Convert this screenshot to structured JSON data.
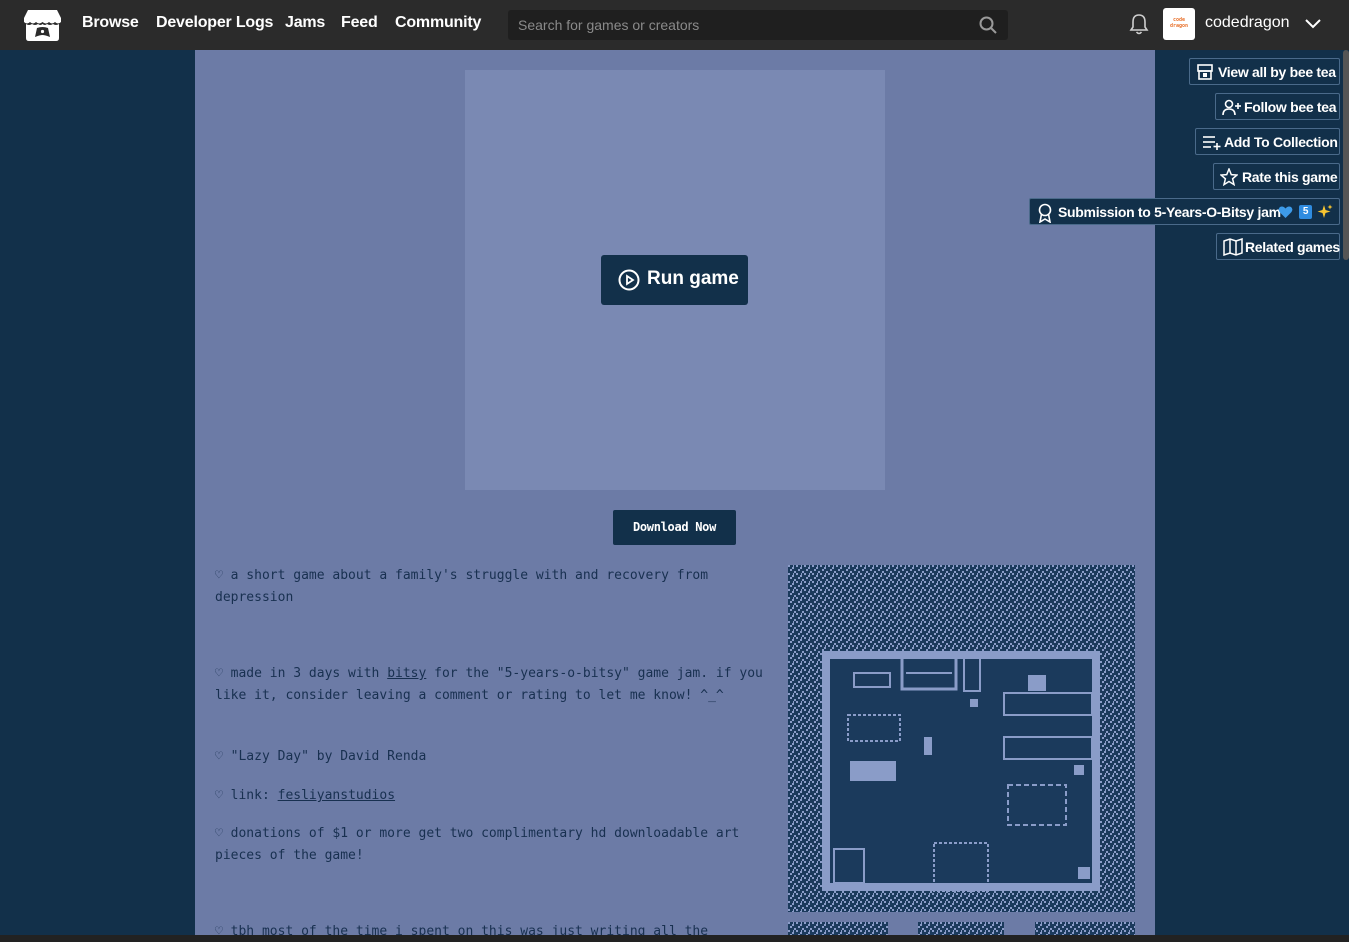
{
  "nav": {
    "links": [
      "Browse",
      "Developer Logs",
      "Jams",
      "Feed",
      "Community"
    ],
    "search_placeholder": "Search for games or creators",
    "username": "codedragon",
    "avatar_text": "code dragon"
  },
  "game": {
    "run_label": "Run game",
    "download_label": "Download Now"
  },
  "description": {
    "p1": "♡ a short game about a family's struggle with and recovery from depression",
    "p2_prefix": "♡ made in 3 days with ",
    "p2_link": "bitsy",
    "p2_suffix": " for the \"5-years-o-bitsy\" game jam. if you like it, consider leaving a comment or rating to let me know! ^_^",
    "p3": "♡ \"Lazy Day\" by David Renda",
    "p4_prefix": "♡ link: ",
    "p4_link": "fesliyanstudios",
    "p5": "♡ donations of $1 or more get two complimentary hd downloadable art pieces of the game!",
    "p6": "♡ tbh most of the time i spent on this was just writing all the"
  },
  "sidebar": {
    "view_all": "View all by bee tea",
    "follow": "Follow bee tea",
    "add_collection": "Add To Collection",
    "rate": "Rate this game",
    "submission": "Submission to 5-Years-O-Bitsy jam",
    "submission_badge": "5",
    "related": "Related games"
  },
  "colors": {
    "topbar": "#2b2b2b",
    "background": "#12304a",
    "page": "#6c7ba6",
    "embed": "#7a89b3",
    "text": "#183050"
  }
}
